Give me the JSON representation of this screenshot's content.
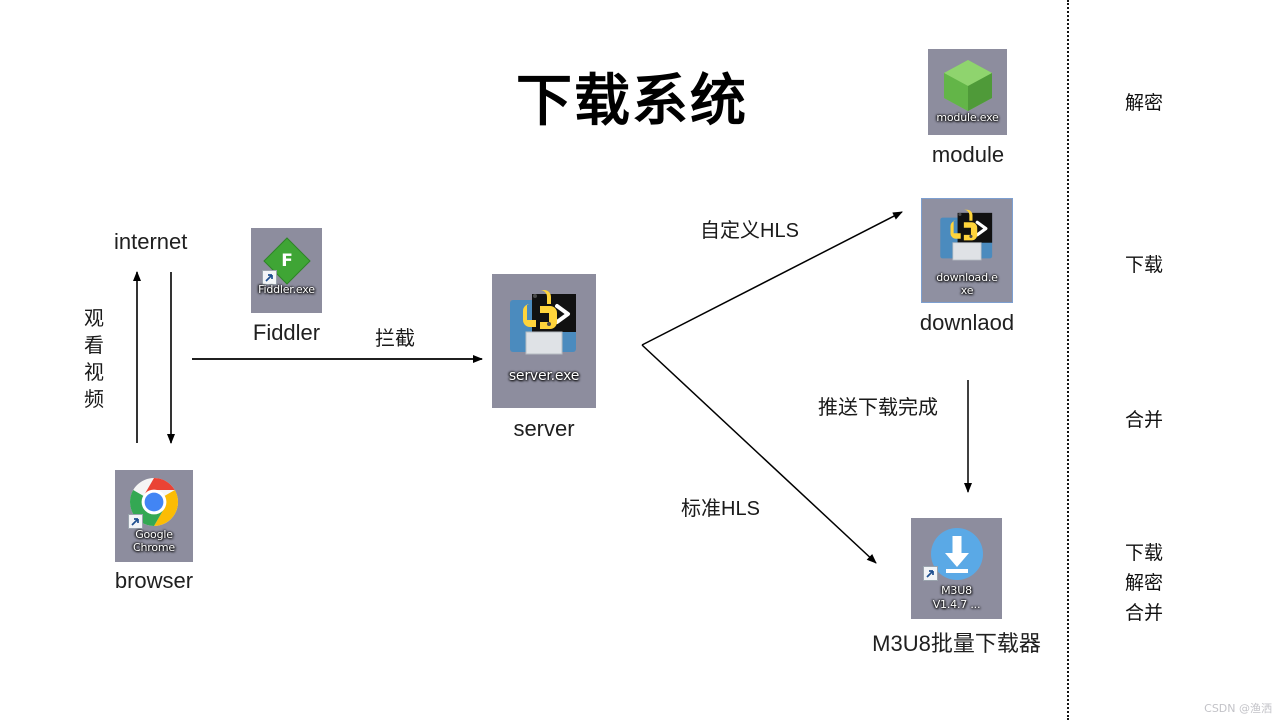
{
  "title": "下载系统",
  "watermark": "CSDN @渔洒",
  "nodes": {
    "internet": {
      "label": "internet"
    },
    "browser": {
      "caption": "browser",
      "icon_name": "google-chrome-icon",
      "filename_line1": "Google",
      "filename_line2": "Chrome"
    },
    "fiddler": {
      "caption": "Fiddler",
      "icon_name": "fiddler-icon",
      "filename_line1": "Fiddler.exe",
      "filename_line2": ""
    },
    "server": {
      "caption": "server",
      "icon_name": "python-exe-icon",
      "filename_line1": "server.exe",
      "filename_line2": ""
    },
    "module": {
      "caption": "module",
      "icon_name": "green-cube-module-icon",
      "filename_line1": "module.exe",
      "filename_line2": ""
    },
    "download": {
      "caption": "downlaod",
      "icon_name": "python-exe-icon",
      "filename_line1": "download.e",
      "filename_line2": "xe"
    },
    "m3u8": {
      "caption": "M3U8批量下载器",
      "icon_name": "m3u8-downloader-icon",
      "filename_line1": "M3U8",
      "filename_line2": "V1.4.7 ..."
    }
  },
  "edges": {
    "watch_video": "观看视频",
    "intercept": "拦截",
    "custom_hls": "自定义HLS",
    "standard_hls": "标准HLS",
    "push_done": "推送下载完成"
  },
  "side_notes": [
    {
      "text": "解密"
    },
    {
      "text": "下载"
    },
    {
      "text": "合并"
    },
    {
      "line1": "下载",
      "line2": "解密",
      "line3": "合并"
    }
  ],
  "colors": {
    "icon_tile_bg": "#8d8d9e",
    "fiddler_green": "#3fa535",
    "module_green": "#6cbf4b",
    "m3u8_blue": "#5aa9e6",
    "python_yellow": "#ffd43b",
    "python_blue": "#4b8bbe",
    "arrow": "#000000",
    "divider": "#141414"
  }
}
